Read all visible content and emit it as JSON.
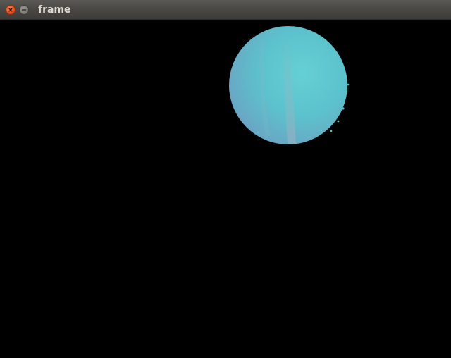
{
  "window": {
    "title": "frame",
    "close_icon": "close-icon",
    "minimize_icon": "minimize-icon"
  },
  "colors": {
    "titlebar": "#4a4945",
    "close_button": "#e95420",
    "background": "#000000",
    "ball": "#5cc4cc"
  }
}
